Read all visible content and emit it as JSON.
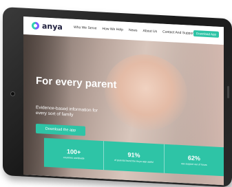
{
  "brand": {
    "name": "anya"
  },
  "nav": {
    "links": [
      "Who We Serve",
      "How We Help",
      "News",
      "About Us",
      "Contact And Support"
    ],
    "cta": "Download App"
  },
  "hero": {
    "headline": "For every parent",
    "subline": "Evidence-based information for every sort of family",
    "button": "Download the app"
  },
  "stats": [
    {
      "value": "100+",
      "label": "countries worldwide"
    },
    {
      "value": "91%",
      "label": "of parents found the Anya app useful"
    },
    {
      "value": "62%",
      "label": "use support out of hours"
    }
  ],
  "colors": {
    "accent": "#2ec4a6",
    "device": "#1f1f1f"
  }
}
